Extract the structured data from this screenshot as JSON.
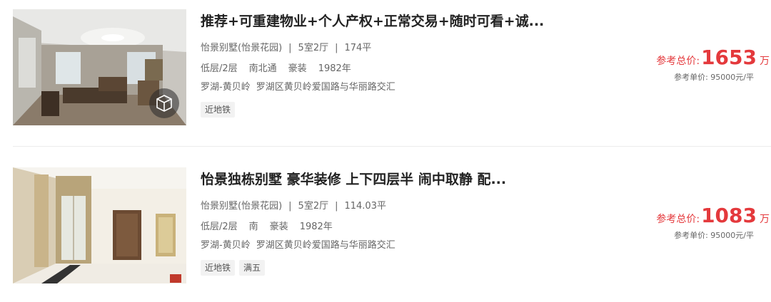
{
  "listings": [
    {
      "title": "推荐+可重建物业+个人产权+正常交易+随时可看+诚...",
      "community": "怡景别墅(怡景花园)",
      "separator": "|",
      "layout": "5室2厅",
      "area": "174平",
      "floor": "低层/2层",
      "orientation": "南北通",
      "decoration": "豪装",
      "year": "1982年",
      "district": "罗湖-黄贝岭",
      "address": "罗湖区黄贝岭爱国路与华丽路交汇",
      "tags": [
        "近地铁"
      ],
      "total_label": "参考总价:",
      "total_value": "1653",
      "total_unit": "万",
      "unit_price": "参考单价:  95000元/平",
      "has_vr": true
    },
    {
      "title": "怡景独栋别墅 豪华装修 上下四层半 闹中取静 配...",
      "community": "怡景别墅(怡景花园)",
      "separator": "|",
      "layout": "5室2厅",
      "area": "114.03平",
      "floor": "低层/2层",
      "orientation": "南",
      "decoration": "豪装",
      "year": "1982年",
      "district": "罗湖-黄贝岭",
      "address": "罗湖区黄贝岭爱国路与华丽路交汇",
      "tags": [
        "近地铁",
        "满五"
      ],
      "total_label": "参考总价:",
      "total_value": "1083",
      "total_unit": "万",
      "unit_price": "参考单价:  95000元/平",
      "has_vr": false
    }
  ],
  "icons": {
    "vr": "vr-cube-icon"
  },
  "colors": {
    "price": "#e4393c",
    "text": "#333333",
    "meta": "#666666",
    "tag_bg": "#f2f2f2"
  }
}
